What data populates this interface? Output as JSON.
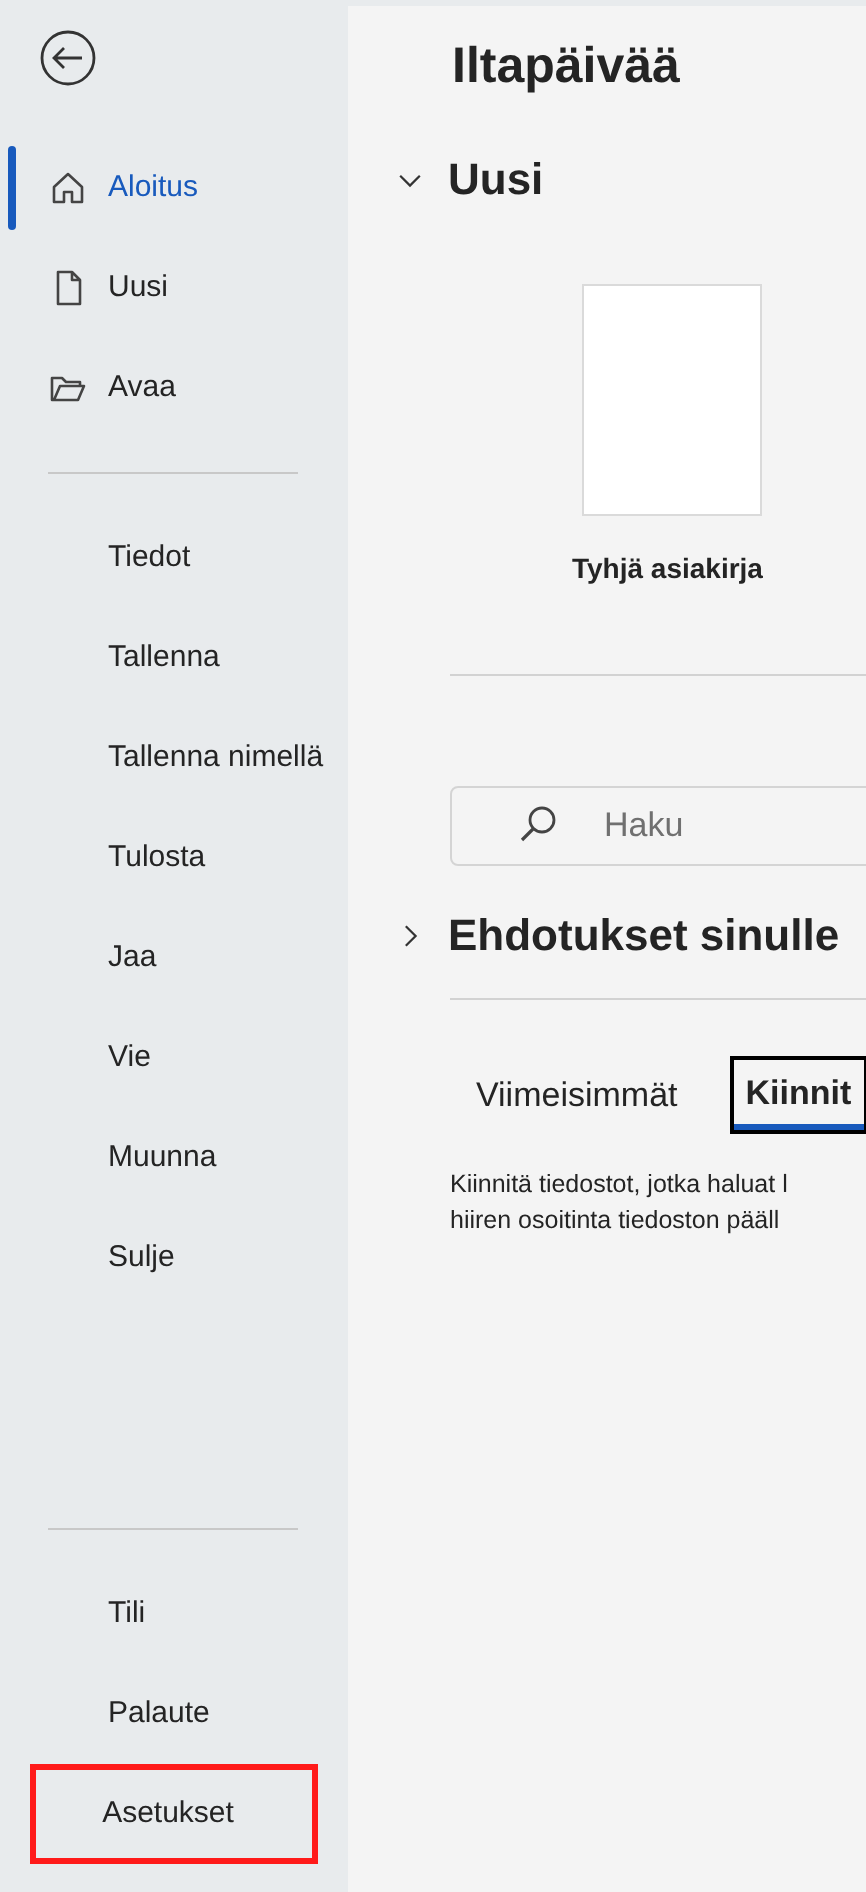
{
  "sidebar": {
    "back": {
      "kind": "back"
    },
    "groups": [
      {
        "items": [
          {
            "label": "Aloitus",
            "kind": "icon",
            "selected": true,
            "highlighted": false
          },
          {
            "label": "Uusi",
            "kind": "icon",
            "selected": false,
            "highlighted": false
          },
          {
            "label": "Avaa",
            "kind": "icon",
            "selected": false,
            "highlighted": false
          }
        ]
      },
      {
        "items": [
          {
            "label": "Tiedot",
            "kind": "text",
            "selected": false,
            "highlighted": false
          },
          {
            "label": "Tallenna",
            "kind": "text",
            "selected": false,
            "highlighted": false
          },
          {
            "label": "Tallenna nimellä",
            "kind": "text",
            "selected": false,
            "highlighted": false
          },
          {
            "label": "Tulosta",
            "kind": "text",
            "selected": false,
            "highlighted": false
          },
          {
            "label": "Jaa",
            "kind": "text",
            "selected": false,
            "highlighted": false
          },
          {
            "label": "Vie",
            "kind": "text",
            "selected": false,
            "highlighted": false
          },
          {
            "label": "Muunna",
            "kind": "text",
            "selected": false,
            "highlighted": false
          },
          {
            "label": "Sulje",
            "kind": "text",
            "selected": false,
            "highlighted": false
          }
        ]
      },
      {
        "items": [
          {
            "label": "Tili",
            "kind": "text",
            "selected": false,
            "highlighted": false
          },
          {
            "label": "Palaute",
            "kind": "text",
            "selected": false,
            "highlighted": false
          },
          {
            "label": "Asetukset",
            "kind": "text",
            "selected": false,
            "highlighted": true
          }
        ]
      }
    ]
  },
  "main": {
    "greeting": "Iltapäivää",
    "new_section": {
      "title": "Uusi",
      "expanded": true,
      "templates": [
        {
          "label": "Tyhjä asiakirja"
        }
      ]
    },
    "search": {
      "placeholder": "Haku"
    },
    "suggestions": {
      "title": "Ehdotukset sinulle",
      "expanded": false
    },
    "tabs": [
      {
        "label": "Viimeisimmät",
        "selected": false
      },
      {
        "label": "Kiinnit",
        "selected": true
      }
    ],
    "hint": [
      "Kiinnitä tiedostot, jotka haluat l",
      "hiiren osoitinta tiedoston pääll"
    ]
  }
}
